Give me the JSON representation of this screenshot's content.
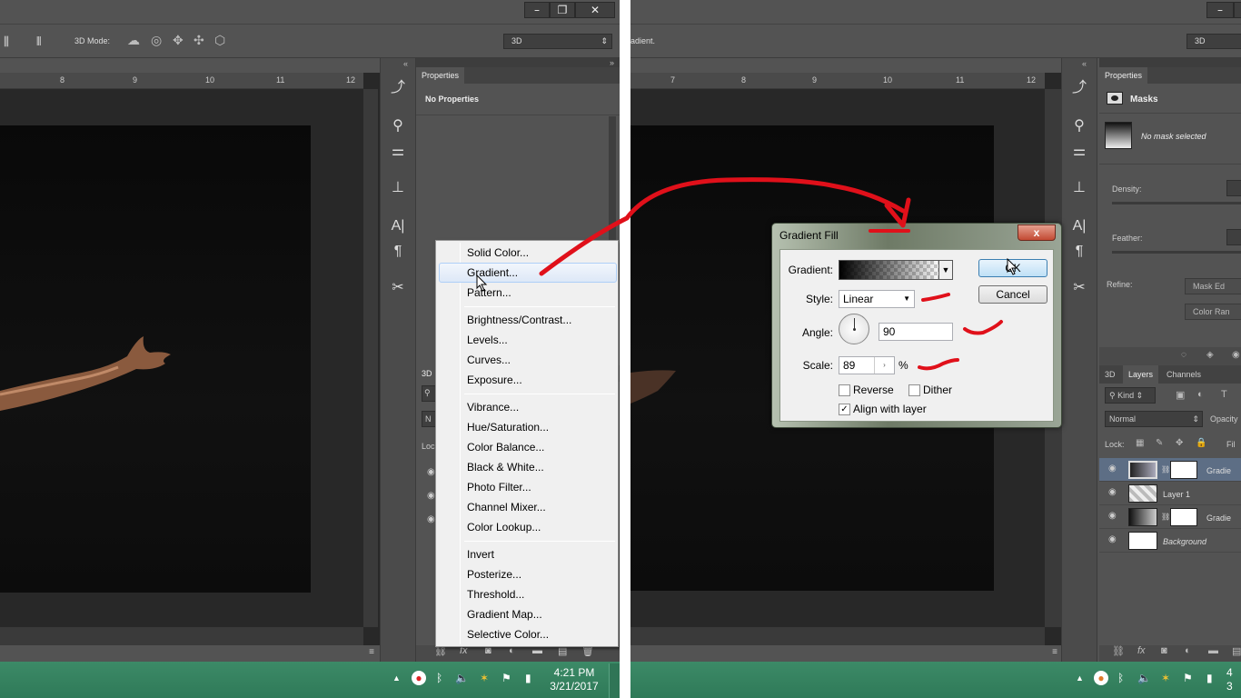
{
  "left": {
    "options_bar": {
      "mode_label": "3D Mode:",
      "select_3d": "3D"
    },
    "ruler_ticks": [
      "8",
      "9",
      "10",
      "11",
      "12"
    ],
    "properties": {
      "tab": "Properties",
      "title": "No Properties"
    },
    "layers_stub": {
      "tab": "3D",
      "kind_row": "N",
      "lock_row": "Loc"
    },
    "context_menu": {
      "group1": [
        "Solid Color...",
        "Gradient...",
        "Pattern..."
      ],
      "group2": [
        "Brightness/Contrast...",
        "Levels...",
        "Curves...",
        "Exposure..."
      ],
      "group3": [
        "Vibrance...",
        "Hue/Saturation...",
        "Color Balance...",
        "Black & White...",
        "Photo Filter...",
        "Channel Mixer...",
        "Color Lookup..."
      ],
      "group4": [
        "Invert",
        "Posterize...",
        "Threshold...",
        "Gradient Map...",
        "Selective Color..."
      ]
    },
    "taskbar": {
      "time": "4:21 PM",
      "date": "3/21/2017"
    }
  },
  "right": {
    "options_bar": {
      "tool_text": "adient.",
      "select_3d": "3D"
    },
    "ruler_ticks": [
      "7",
      "8",
      "9",
      "10",
      "11",
      "12"
    ],
    "properties": {
      "tab": "Properties",
      "section": "Masks",
      "mask_status": "No mask selected",
      "density_label": "Density:",
      "feather_label": "Feather:",
      "refine_label": "Refine:",
      "mask_edge_btn": "Mask Ed",
      "color_range_btn": "Color Ran"
    },
    "layers": {
      "tabs": [
        "3D",
        "Layers",
        "Channels"
      ],
      "kind_label": "Kind",
      "blend_mode": "Normal",
      "opacity_label": "Opacity",
      "lock_label": "Lock:",
      "fill_label": "Fil",
      "rows": [
        "Gradie",
        "Layer 1",
        "Gradie",
        "Background"
      ]
    },
    "dialog": {
      "title": "Gradient Fill",
      "close": "x",
      "gradient_label": "Gradient:",
      "style_label": "Style:",
      "style_value": "Linear",
      "angle_label": "Angle:",
      "angle_value": "90",
      "scale_label": "Scale:",
      "scale_value": "89",
      "scale_unit": "%",
      "reverse_label": "Reverse",
      "dither_label": "Dither",
      "align_label": "Align with layer",
      "ok_label": "OK",
      "cancel_label": "Cancel",
      "checks": {
        "reverse": false,
        "dither": false,
        "align": true
      }
    },
    "taskbar": {
      "clock_partial_1": "4",
      "clock_partial_2": "3"
    }
  },
  "icons": {
    "minimize": "minimize-icon",
    "restore": "restore-icon",
    "close": "close-icon"
  },
  "annotation_color": "#e0101a"
}
